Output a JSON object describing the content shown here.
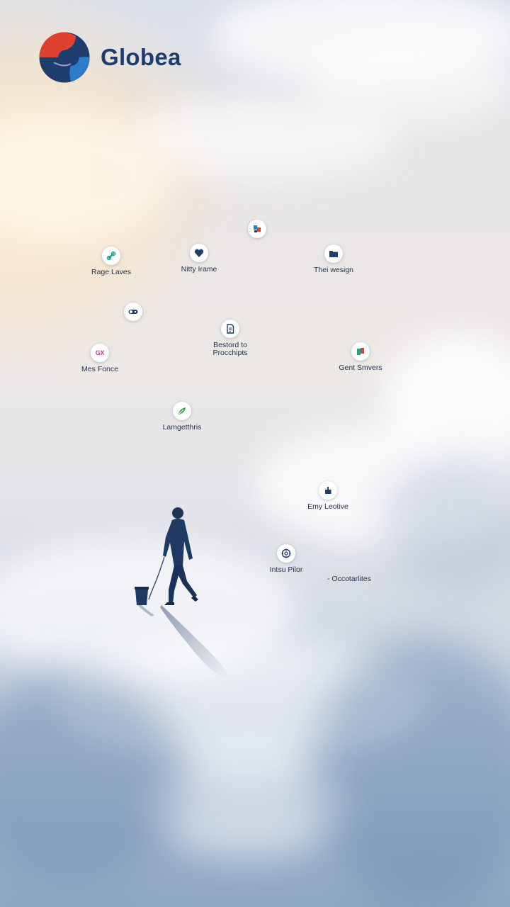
{
  "brand": {
    "name": "Globea",
    "colors": {
      "red": "#e0412f",
      "navy": "#1e3c6e",
      "blue": "#2a7ec9"
    }
  },
  "nodes": [
    {
      "id": "top",
      "label": "",
      "icon": "flag-badge-icon"
    },
    {
      "id": "rage",
      "label": "Rage Laves",
      "icon": "link-icon"
    },
    {
      "id": "nitty",
      "label": "Nitty Irame",
      "icon": "heart-icon"
    },
    {
      "id": "thei",
      "label": "Thei wesign",
      "icon": "folder-icon"
    },
    {
      "id": "toggle",
      "label": "",
      "icon": "toggle-icon"
    },
    {
      "id": "bestord",
      "label": "Bestord to\nProcchipts",
      "icon": "document-icon"
    },
    {
      "id": "mes",
      "label": "Mes Fonce",
      "icon": "text-badge-icon",
      "icon_text": "GX"
    },
    {
      "id": "gent",
      "label": "Gent Smvers",
      "icon": "tag-icon"
    },
    {
      "id": "lamg",
      "label": "Lamgetthris",
      "icon": "leaf-icon"
    },
    {
      "id": "emy",
      "label": "Emy Leotive",
      "icon": "thumb-icon"
    },
    {
      "id": "intsu",
      "label": "Intsu Pilor",
      "icon": "dial-icon"
    }
  ],
  "extra_label": "- Occotarlites",
  "scene": {
    "figure": "walking-person",
    "object": "trash-bin"
  }
}
